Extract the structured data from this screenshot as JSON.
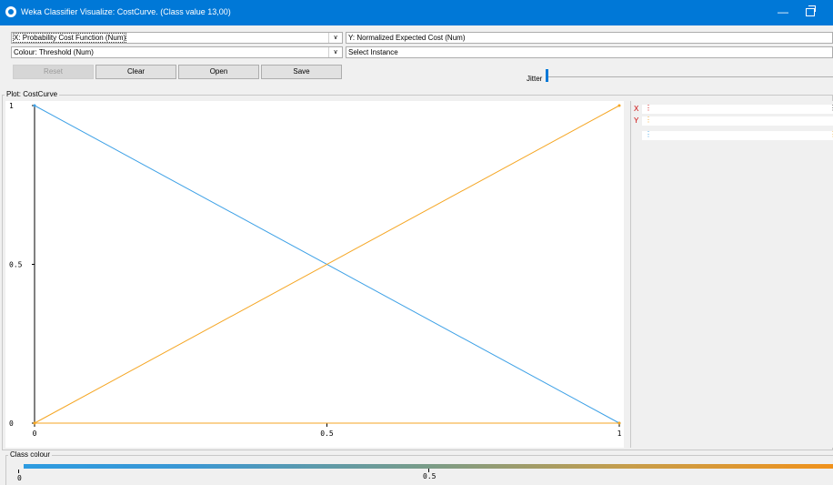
{
  "window": {
    "title": "Weka Classifier Visualize: CostCurve. (Class value 13,00)"
  },
  "controls": {
    "x_axis": "X: Probability Cost Function (Num)",
    "y_axis": "Y: Normalized Expected Cost (Num)",
    "colour": "Colour: Threshold (Num)",
    "select_instance": "Select Instance",
    "buttons": {
      "reset": "Reset",
      "clear": "Clear",
      "open": "Open",
      "save": "Save"
    },
    "jitter_label": "Jitter",
    "jitter_value": 0
  },
  "plot": {
    "title": "Plot: CostCurve"
  },
  "side_panel": {
    "x_label": "X",
    "y_label": "Y"
  },
  "class_colour": {
    "title": "Class colour",
    "min_label": "0",
    "mid_label": "0.5"
  },
  "chart_data": {
    "type": "line",
    "xlim": [
      0,
      1
    ],
    "ylim": [
      0,
      1
    ],
    "x_ticks": [
      "0",
      "0.5",
      "1"
    ],
    "y_ticks": [
      "0",
      "0.5",
      "1"
    ],
    "series": [
      {
        "color": "#3ca0e6",
        "points": [
          [
            0,
            1
          ],
          [
            1,
            0
          ]
        ]
      },
      {
        "color": "#f5a623",
        "points": [
          [
            0,
            0
          ],
          [
            1,
            1
          ]
        ]
      },
      {
        "color": "#f5a623",
        "points": [
          [
            0,
            0
          ],
          [
            1,
            0
          ]
        ]
      }
    ]
  }
}
